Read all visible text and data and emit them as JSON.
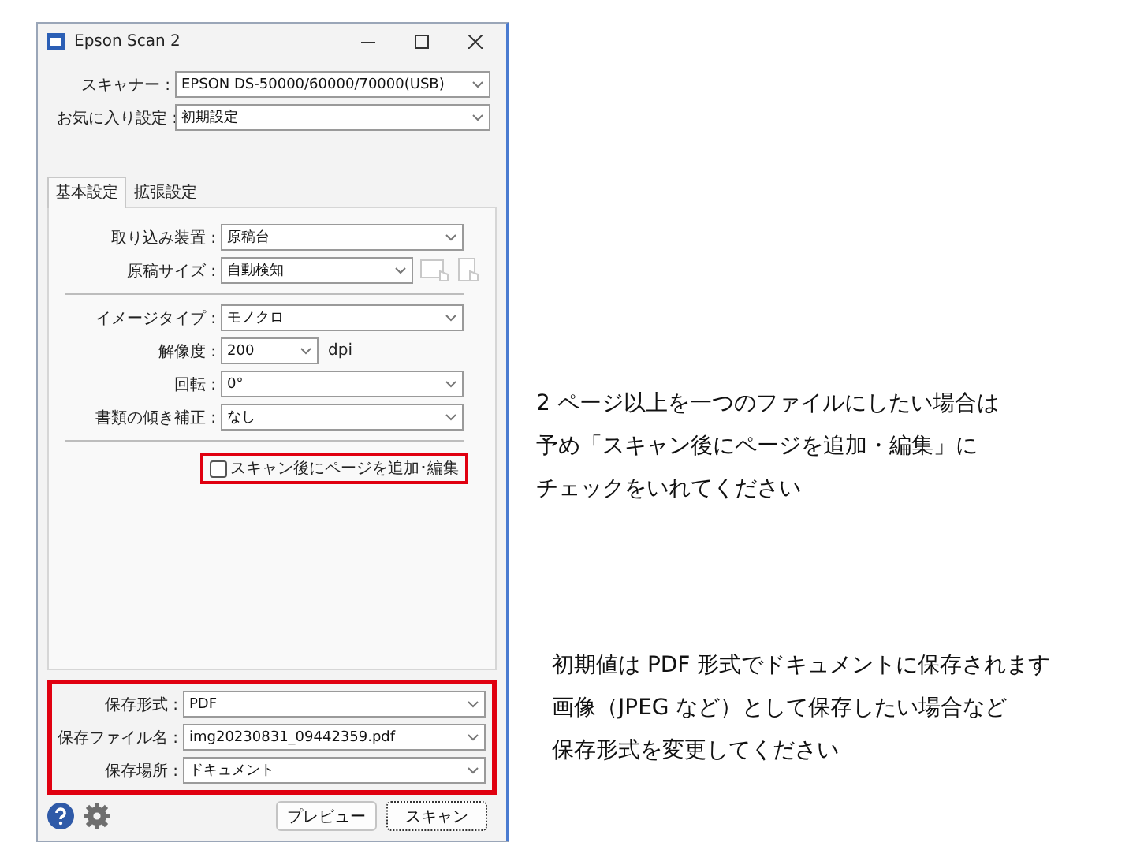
{
  "window": {
    "title": "Epson Scan 2"
  },
  "top_rows": [
    {
      "label": "スキャナー :",
      "value": "EPSON DS-50000/60000/70000(USB)"
    },
    {
      "label": "お気に入り設定 :",
      "value": "初期設定"
    }
  ],
  "tabs": [
    {
      "label": "基本設定",
      "selected": true
    },
    {
      "label": "拡張設定",
      "selected": false
    }
  ],
  "setting_groups": [
    {
      "rows": [
        {
          "kind": "select",
          "label": "取り込み装置 :",
          "value": "原稿台"
        },
        {
          "kind": "size",
          "label": "原稿サイズ :",
          "value": "自動検知"
        }
      ]
    },
    {
      "rows": [
        {
          "kind": "select",
          "label": "イメージタイプ :",
          "value": "モノクロ"
        },
        {
          "kind": "unit",
          "label": "解像度 :",
          "value": "200",
          "unit": "dpi"
        },
        {
          "kind": "select",
          "label": "回転 :",
          "value": "0°"
        },
        {
          "kind": "select",
          "label": "書類の傾き補正 :",
          "value": "なし"
        }
      ]
    }
  ],
  "add_pages": {
    "label": "スキャン後にページを追加･編集",
    "checked": false,
    "highlighted": true
  },
  "save": {
    "highlighted": true,
    "rows": [
      {
        "label": "保存形式 :",
        "value": "PDF"
      },
      {
        "label": "保存ファイル名 :",
        "value": "img20230831_09442359.pdf"
      },
      {
        "label": "保存場所 :",
        "value": "ドキュメント"
      }
    ]
  },
  "buttons": [
    {
      "label": "プレビュー",
      "focused": false
    },
    {
      "label": "スキャン",
      "focused": true
    }
  ],
  "notes": [
    {
      "lines": [
        "2 ページ以上を一つのファイルにしたい場合は",
        "予め「スキャン後にページを追加・編集」に",
        "チェックをいれてください"
      ]
    },
    {
      "lines": [
        "初期値は PDF 形式でドキュメントに保存されます",
        "画像（JPEG など）として保存したい場合など",
        "保存形式を変更してください"
      ]
    }
  ]
}
